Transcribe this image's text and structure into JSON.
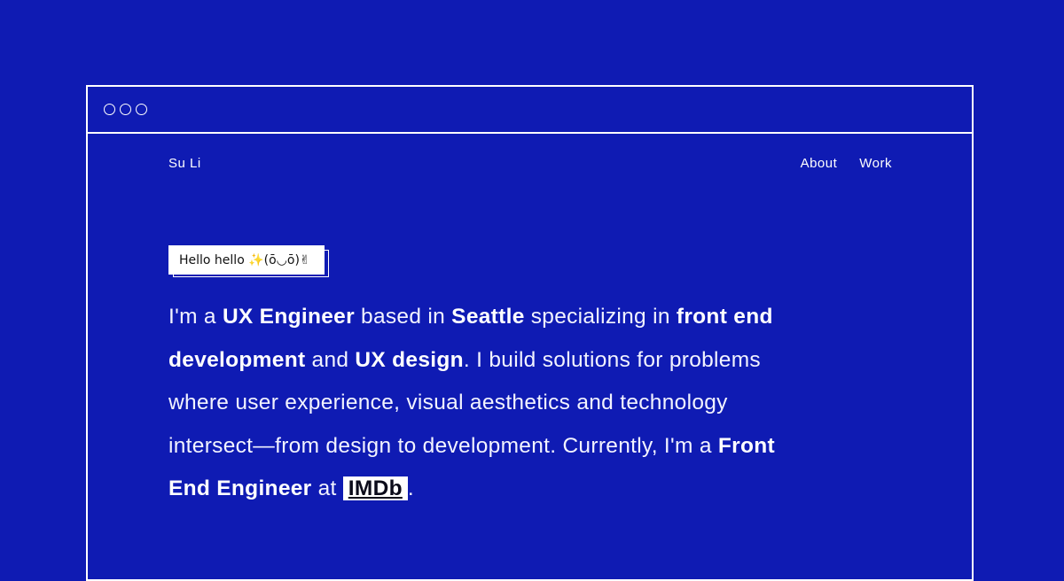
{
  "window": {
    "dots": [
      "circle-icon",
      "circle-icon",
      "circle-icon"
    ]
  },
  "nav": {
    "brand": "Su Li",
    "links": [
      "About",
      "Work"
    ]
  },
  "greeting": "Hello hello ✨(ō◡ō)✌",
  "intro": {
    "p1": "I'm a ",
    "b1": "UX Engineer",
    "p2": " based in ",
    "b2": "Seattle",
    "p3": " specializing in ",
    "b3": "front end development",
    "p4": " and ",
    "b4": "UX design",
    "p5": ". I build solutions for problems where user experience, visual aesthetics and technology intersect—from design to development. Currently, I'm a ",
    "b5": "Front End Engineer",
    "p6": " at ",
    "link": "IMDb",
    "p7": "."
  },
  "colors": {
    "background": "#0f1bb3",
    "foreground": "#ffffff"
  }
}
